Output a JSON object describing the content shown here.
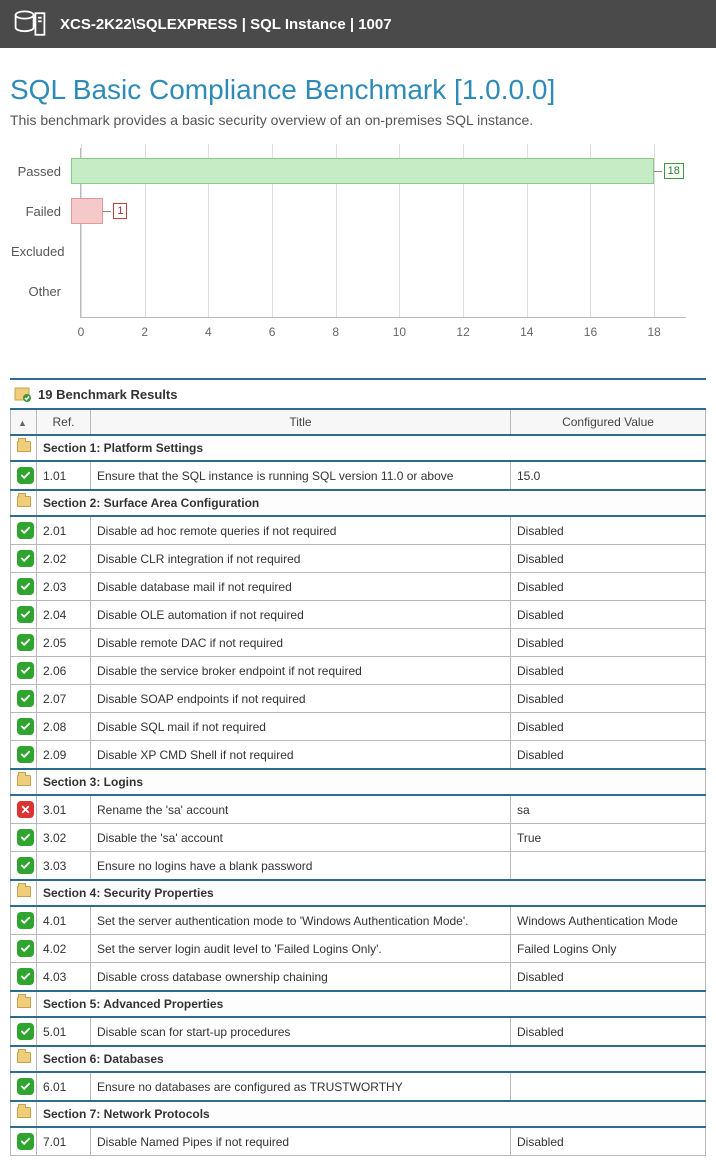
{
  "header": {
    "title": "XCS-2K22\\SQLEXPRESS | SQL Instance | 1007"
  },
  "page": {
    "title": "SQL Basic Compliance Benchmark [1.0.0.0]",
    "description": "This benchmark provides a basic security overview of an on-premises SQL instance."
  },
  "chart_data": {
    "type": "bar",
    "orientation": "horizontal",
    "categories": [
      "Passed",
      "Failed",
      "Excluded",
      "Other"
    ],
    "values": [
      18,
      1,
      0,
      0
    ],
    "xlabel": "",
    "ylabel": "",
    "xlim": [
      0,
      19
    ],
    "xticks": [
      0,
      2,
      4,
      6,
      8,
      10,
      12,
      14,
      16,
      18
    ],
    "colors": {
      "Passed": "#c6ecc6",
      "Failed": "#f5c9c9"
    }
  },
  "results_header": "19 Benchmark Results",
  "columns": {
    "ref": "Ref.",
    "title": "Title",
    "value": "Configured Value"
  },
  "sections": [
    {
      "title": "Section 1: Platform Settings",
      "rows": [
        {
          "status": "pass",
          "ref": "1.01",
          "title": "Ensure that the SQL instance is running SQL version 11.0 or above",
          "value": "15.0"
        }
      ]
    },
    {
      "title": "Section 2: Surface Area Configuration",
      "rows": [
        {
          "status": "pass",
          "ref": "2.01",
          "title": "Disable ad hoc remote queries if not required",
          "value": "Disabled"
        },
        {
          "status": "pass",
          "ref": "2.02",
          "title": "Disable CLR integration if not required",
          "value": "Disabled"
        },
        {
          "status": "pass",
          "ref": "2.03",
          "title": "Disable database mail if not required",
          "value": "Disabled"
        },
        {
          "status": "pass",
          "ref": "2.04",
          "title": "Disable OLE automation if not required",
          "value": "Disabled"
        },
        {
          "status": "pass",
          "ref": "2.05",
          "title": "Disable remote DAC if not required",
          "value": "Disabled"
        },
        {
          "status": "pass",
          "ref": "2.06",
          "title": "Disable the service broker endpoint if not required",
          "value": "Disabled"
        },
        {
          "status": "pass",
          "ref": "2.07",
          "title": "Disable SOAP endpoints if not required",
          "value": "Disabled"
        },
        {
          "status": "pass",
          "ref": "2.08",
          "title": "Disable SQL mail if not required",
          "value": "Disabled"
        },
        {
          "status": "pass",
          "ref": "2.09",
          "title": "Disable XP CMD Shell if not required",
          "value": "Disabled"
        }
      ]
    },
    {
      "title": "Section 3: Logins",
      "rows": [
        {
          "status": "fail",
          "ref": "3.01",
          "title": "Rename the 'sa' account",
          "value": "sa"
        },
        {
          "status": "pass",
          "ref": "3.02",
          "title": "Disable the 'sa' account",
          "value": "True"
        },
        {
          "status": "pass",
          "ref": "3.03",
          "title": "Ensure no logins have a blank password",
          "value": ""
        }
      ]
    },
    {
      "title": "Section 4: Security Properties",
      "rows": [
        {
          "status": "pass",
          "ref": "4.01",
          "title": "Set the server authentication mode to 'Windows Authentication Mode'.",
          "value": "Windows Authentication Mode"
        },
        {
          "status": "pass",
          "ref": "4.02",
          "title": "Set the server login audit level to 'Failed Logins Only'.",
          "value": "Failed Logins Only"
        },
        {
          "status": "pass",
          "ref": "4.03",
          "title": "Disable cross database ownership chaining",
          "value": "Disabled"
        }
      ]
    },
    {
      "title": "Section 5: Advanced Properties",
      "rows": [
        {
          "status": "pass",
          "ref": "5.01",
          "title": "Disable scan for start-up procedures",
          "value": "Disabled"
        }
      ]
    },
    {
      "title": "Section 6: Databases",
      "rows": [
        {
          "status": "pass",
          "ref": "6.01",
          "title": "Ensure no databases are configured as TRUSTWORTHY",
          "value": ""
        }
      ]
    },
    {
      "title": "Section 7: Network Protocols",
      "rows": [
        {
          "status": "pass",
          "ref": "7.01",
          "title": "Disable Named Pipes if not required",
          "value": "Disabled"
        }
      ]
    }
  ]
}
